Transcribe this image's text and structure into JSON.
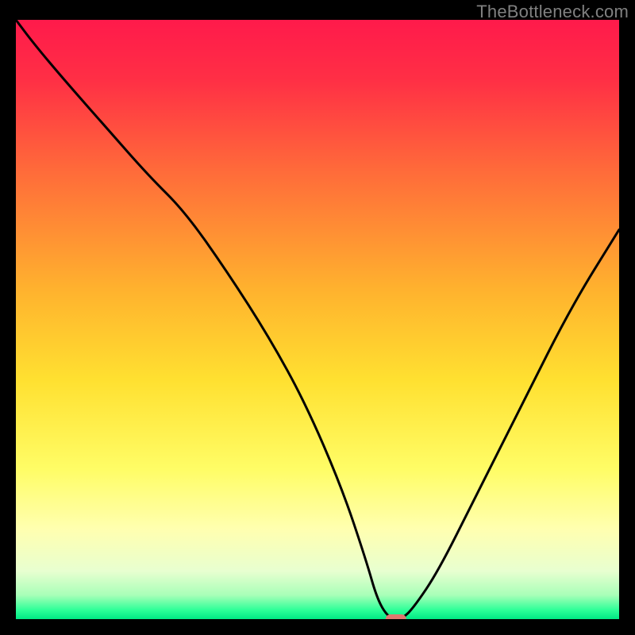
{
  "watermark": "TheBottleneck.com",
  "chart_data": {
    "type": "line",
    "title": "",
    "xlabel": "",
    "ylabel": "",
    "xlim": [
      0,
      100
    ],
    "ylim": [
      0,
      100
    ],
    "grid": false,
    "legend": false,
    "gradient_stops": [
      {
        "pct": 0,
        "color": "#ff1a4b"
      },
      {
        "pct": 10,
        "color": "#ff2f45"
      },
      {
        "pct": 25,
        "color": "#ff6a3a"
      },
      {
        "pct": 45,
        "color": "#ffb22e"
      },
      {
        "pct": 60,
        "color": "#ffe030"
      },
      {
        "pct": 75,
        "color": "#fffd66"
      },
      {
        "pct": 85,
        "color": "#ffffb0"
      },
      {
        "pct": 92,
        "color": "#e8ffd0"
      },
      {
        "pct": 96,
        "color": "#a8ffb8"
      },
      {
        "pct": 98.5,
        "color": "#2dff98"
      },
      {
        "pct": 100,
        "color": "#00e884"
      }
    ],
    "series": [
      {
        "name": "bottleneck-curve",
        "color": "#000000",
        "x": [
          0,
          3,
          8,
          15,
          22,
          28,
          35,
          42,
          48,
          54,
          58,
          60,
          62,
          64,
          66,
          70,
          76,
          84,
          92,
          100
        ],
        "y": [
          100,
          96,
          90,
          82,
          74,
          68,
          58,
          47,
          36,
          22,
          10,
          3,
          0,
          0,
          2,
          8,
          20,
          36,
          52,
          65
        ]
      }
    ],
    "markers": [
      {
        "name": "bottleneck-marker",
        "x": 63,
        "y": 0,
        "color": "#e0776f",
        "shape": "pill"
      }
    ]
  }
}
